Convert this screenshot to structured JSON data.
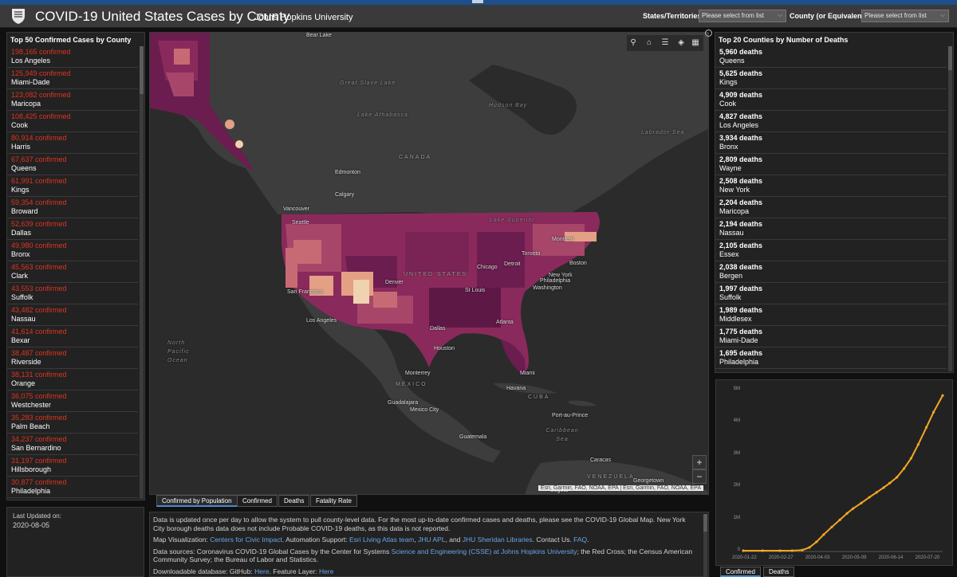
{
  "header": {
    "title": "COVID-19 United States Cases by County",
    "subtitle": "Johns Hopkins University",
    "states_label": "States/Territories",
    "states_placeholder": "Please select from list",
    "county_label": "County (or Equivalent)",
    "county_placeholder": "Please select from list"
  },
  "left_panel": {
    "title": "Top 50 Confirmed Cases by County",
    "items": [
      {
        "value": "198,165 confirmed",
        "name": "Los Angeles"
      },
      {
        "value": "125,949 confirmed",
        "name": "Miami-Dade"
      },
      {
        "value": "123,082 confirmed",
        "name": "Maricopa"
      },
      {
        "value": "108,425 confirmed",
        "name": "Cook"
      },
      {
        "value": "80,914 confirmed",
        "name": "Harris"
      },
      {
        "value": "67,637 confirmed",
        "name": "Queens"
      },
      {
        "value": "61,991 confirmed",
        "name": "Kings"
      },
      {
        "value": "59,354 confirmed",
        "name": "Broward"
      },
      {
        "value": "52,639 confirmed",
        "name": "Dallas"
      },
      {
        "value": "49,980 confirmed",
        "name": "Bronx"
      },
      {
        "value": "45,563 confirmed",
        "name": "Clark"
      },
      {
        "value": "43,553 confirmed",
        "name": "Suffolk"
      },
      {
        "value": "43,482 confirmed",
        "name": "Nassau"
      },
      {
        "value": "41,614 confirmed",
        "name": "Bexar"
      },
      {
        "value": "38,487 confirmed",
        "name": "Riverside"
      },
      {
        "value": "38,131 confirmed",
        "name": "Orange"
      },
      {
        "value": "36,075 confirmed",
        "name": "Westchester"
      },
      {
        "value": "35,283 confirmed",
        "name": "Palm Beach"
      },
      {
        "value": "34,237 confirmed",
        "name": "San Bernardino"
      },
      {
        "value": "31,197 confirmed",
        "name": "Hillsborough"
      },
      {
        "value": "30,877 confirmed",
        "name": "Philadelphia"
      }
    ]
  },
  "last_updated": {
    "label": "Last Updated on:",
    "date": "2020-08-05"
  },
  "right_panel": {
    "title": "Top 20 Counties by Number of Deaths",
    "items": [
      {
        "value": "5,960 deaths",
        "name": "Queens"
      },
      {
        "value": "5,625 deaths",
        "name": "Kings"
      },
      {
        "value": "4,909 deaths",
        "name": "Cook"
      },
      {
        "value": "4,827 deaths",
        "name": "Los Angeles"
      },
      {
        "value": "3,934 deaths",
        "name": "Bronx"
      },
      {
        "value": "2,809 deaths",
        "name": "Wayne"
      },
      {
        "value": "2,508 deaths",
        "name": "New York"
      },
      {
        "value": "2,204 deaths",
        "name": "Maricopa"
      },
      {
        "value": "2,194 deaths",
        "name": "Nassau"
      },
      {
        "value": "2,105 deaths",
        "name": "Essex"
      },
      {
        "value": "2,038 deaths",
        "name": "Bergen"
      },
      {
        "value": "1,997 deaths",
        "name": "Suffolk"
      },
      {
        "value": "1,989 deaths",
        "name": "Middlesex"
      },
      {
        "value": "1,775 deaths",
        "name": "Miami-Dade"
      },
      {
        "value": "1,695 deaths",
        "name": "Philadelphia"
      }
    ]
  },
  "map": {
    "labels": {
      "canada": "CANADA",
      "united_states": "UNITED STATES",
      "mexico": "MÉXICO",
      "cuba": "CUBA",
      "venezuela": "VENEZUELA",
      "hudson_bay": "Hudson Bay",
      "labrador_sea": "Labrador Sea",
      "north_pacific": "North Pacific Ocean",
      "caribbean_sea": "Caribbean Sea",
      "great_slave_lake": "Great Slave Lake",
      "lake_athabasca": "Lake Athabasca",
      "bear_lake": "Bear Lake",
      "lake_superior": "Lake Superior",
      "edmonton": "Edmonton",
      "calgary": "Calgary",
      "vancouver": "Vancouver",
      "seattle": "Seattle",
      "san_francisco": "San Francisco",
      "los_angeles": "Los Angeles",
      "denver": "Denver",
      "dallas": "Dallas",
      "houston": "Houston",
      "st_louis": "St Louis",
      "chicago": "Chicago",
      "detroit": "Detroit",
      "toronto": "Toronto",
      "montreal": "Montreal",
      "boston": "Boston",
      "new_york": "New York",
      "philadelphia": "Philadelphia",
      "washington": "Washington",
      "atlanta": "Atlanta",
      "miami": "Miami",
      "monterrey": "Monterrey",
      "havana": "Havana",
      "guadalajara": "Guadalajara",
      "mexico_city": "Mexico City",
      "port_au_prince": "Port-au-Prince",
      "guatemala": "Guatemala",
      "caracas": "Caracas",
      "georgetown": "Georgetown",
      "bogota": "Bogotá"
    },
    "attribution": "Esri, Garmin, FAO, NOAA, EPA | Esri, Garmin, FAO, NOAA, EPA",
    "tools": [
      "search-icon",
      "home-icon",
      "list-icon",
      "layers-icon",
      "qr-icon"
    ],
    "zoom_in": "+",
    "zoom_out": "−",
    "choropleth_colors": [
      "#6b1d4f",
      "#8a2a5c",
      "#a8466a",
      "#c86a74",
      "#e3a085",
      "#f0d2b0"
    ]
  },
  "map_tabs": [
    "Confirmed by Population",
    "Confirmed",
    "Deaths",
    "Fatality Rate"
  ],
  "info": {
    "p1": "Data is updated once per day to allow the system to pull county-level data. For the most up-to-date confirmed cases and deaths, please see the COVID-19 Global Map. New York City borough deaths data does not include Probable COVID-19 deaths, as this data is not reported.",
    "p2_prefix": "Map Visualization: ",
    "p2_link1": "Centers for Civic Impact",
    "p2_mid": ". Automation Support: ",
    "p2_link2": "Esri Living Atlas team",
    "p2_sep": ", ",
    "p2_link3": "JHU APL",
    "p2_and": ", and ",
    "p2_link4": "JHU Sheridan Libraries",
    "p2_contact": ". Contact Us. ",
    "p2_faq": "FAQ",
    "p2_end": ".",
    "p3_prefix": "Data sources: Coronavirus COVID-19 Global Cases by the Center for Systems ",
    "p3_link": "Science and Engineering (CSSE) at Johns Hopkins University",
    "p3_rest": "; the Red Cross; the Census American Community Survey; the Bureau of Labor and Statistics.",
    "p4_prefix": "Downloadable database: GitHub: ",
    "p4_link1": "Here",
    "p4_mid": ". Feature Layer: ",
    "p4_link2": "Here"
  },
  "chart_tabs": [
    "Confirmed",
    "Deaths"
  ],
  "chart_data": {
    "type": "line",
    "title": "",
    "xlabel": "",
    "ylabel": "",
    "y_ticks": [
      "0",
      "1M",
      "2M",
      "3M",
      "4M",
      "5M"
    ],
    "x_ticks": [
      "2020-01-22",
      "2020-02-27",
      "2020-04-03",
      "2020-05-09",
      "2020-06-14",
      "2020-07-20"
    ],
    "ylim": [
      0,
      5000000
    ],
    "series": [
      {
        "color": "#f5a623",
        "x": [
          "2020-01-22",
          "2020-02-10",
          "2020-02-27",
          "2020-03-10",
          "2020-03-20",
          "2020-03-27",
          "2020-04-03",
          "2020-04-10",
          "2020-04-18",
          "2020-04-26",
          "2020-05-03",
          "2020-05-09",
          "2020-05-17",
          "2020-05-25",
          "2020-06-01",
          "2020-06-08",
          "2020-06-14",
          "2020-06-21",
          "2020-06-28",
          "2020-07-05",
          "2020-07-12",
          "2020-07-20",
          "2020-07-27",
          "2020-08-05"
        ],
        "values": [
          0,
          0,
          50,
          1000,
          19000,
          100000,
          275000,
          500000,
          735000,
          960000,
          1160000,
          1310000,
          1480000,
          1660000,
          1810000,
          1960000,
          2100000,
          2280000,
          2550000,
          2870000,
          3300000,
          3830000,
          4300000,
          4820000
        ]
      }
    ]
  }
}
